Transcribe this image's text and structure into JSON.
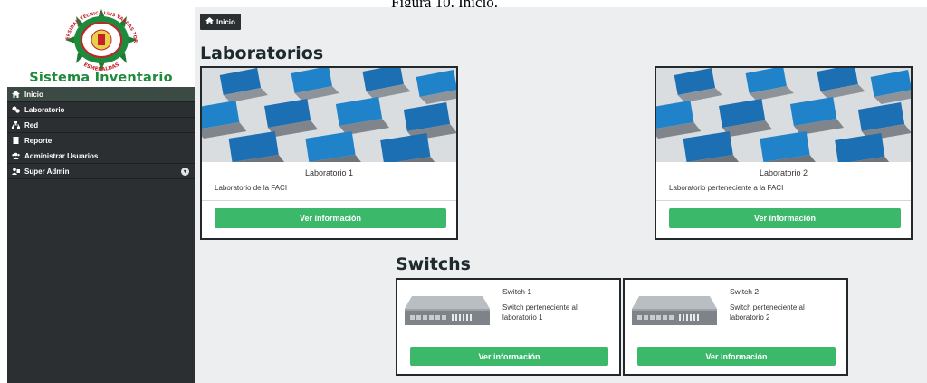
{
  "caption": "Figura 10. Inicio.",
  "sidebar": {
    "brand_title": "Sistema Inventario",
    "logo": {
      "top_text": "UNIVERSIDAD TECNICA LUIS VARGAS TORRES",
      "bottom_text": "ESMERALDAS"
    },
    "items": [
      {
        "label": "Inicio",
        "icon": "home-icon",
        "active": true
      },
      {
        "label": "Laboratorio",
        "icon": "lab-icon"
      },
      {
        "label": "Red",
        "icon": "network-icon"
      },
      {
        "label": "Reporte",
        "icon": "report-icon"
      },
      {
        "label": "Administrar Usuarios",
        "icon": "users-icon"
      },
      {
        "label": "Super Admin",
        "icon": "admin-icon",
        "has_dropdown": true
      }
    ]
  },
  "breadcrumb": {
    "label": "Inicio",
    "icon": "home-icon"
  },
  "laboratorios": {
    "title": "Laboratorios",
    "cards": [
      {
        "name": "Laboratorio 1",
        "description": "Laboratorio de la FACI",
        "button": "Ver información"
      },
      {
        "name": "Laboratorio 2",
        "description": "Laboratorio perteneciente a la FACI",
        "button": "Ver información"
      }
    ]
  },
  "switchs": {
    "title": "Switchs",
    "cards": [
      {
        "name": "Switch 1",
        "description": "Switch perteneciente al laboratorio 1",
        "button": "Ver información"
      },
      {
        "name": "Switch 2",
        "description": "Switch perteneciente al laboratorio 2",
        "button": "Ver información"
      }
    ]
  },
  "colors": {
    "sidebar_bg": "#2b2f31",
    "brand_green": "#1d8a3c",
    "button_green": "#3cb86a",
    "content_bg": "#eceeef"
  }
}
